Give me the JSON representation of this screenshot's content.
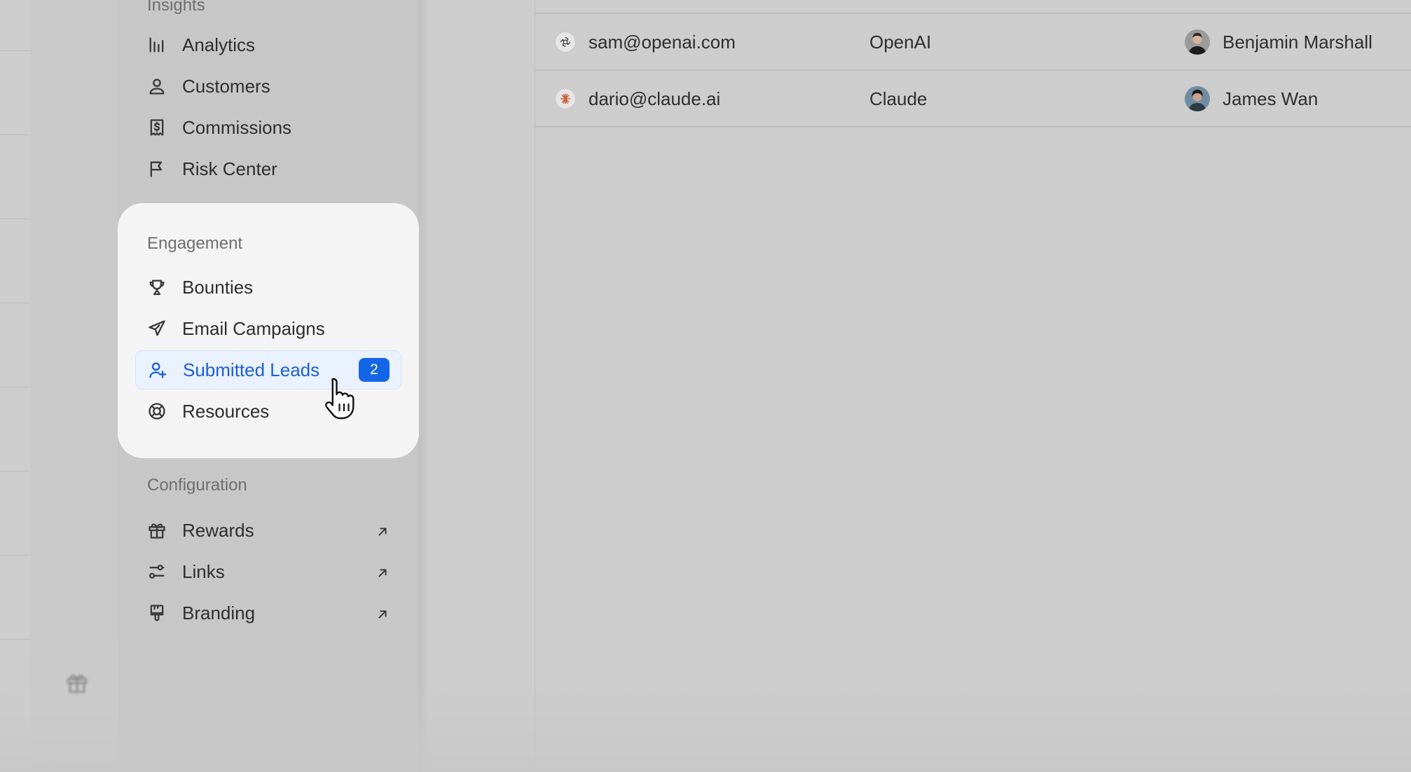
{
  "sidebar": {
    "insights": {
      "label": "Insights",
      "items": [
        {
          "label": "Analytics",
          "icon": "bar-chart-icon"
        },
        {
          "label": "Customers",
          "icon": "user-icon"
        },
        {
          "label": "Commissions",
          "icon": "receipt-dollar-icon"
        },
        {
          "label": "Risk Center",
          "icon": "flag-icon"
        }
      ]
    },
    "engagement": {
      "label": "Engagement",
      "items": [
        {
          "label": "Bounties",
          "icon": "trophy-icon"
        },
        {
          "label": "Email Campaigns",
          "icon": "paper-plane-icon"
        },
        {
          "label": "Submitted Leads",
          "icon": "user-plus-icon",
          "badge": "2",
          "active": true
        },
        {
          "label": "Resources",
          "icon": "lifebuoy-icon"
        }
      ]
    },
    "configuration": {
      "label": "Configuration",
      "items": [
        {
          "label": "Rewards",
          "icon": "gift-icon",
          "external": true
        },
        {
          "label": "Links",
          "icon": "links-icon",
          "external": true
        },
        {
          "label": "Branding",
          "icon": "paintbrush-icon",
          "external": true
        }
      ]
    }
  },
  "table": {
    "rows": [
      {
        "email": "sam@openai.com",
        "company": "OpenAI",
        "owner": "Benjamin Marshall",
        "logo": "openai-logo-icon"
      },
      {
        "email": "dario@claude.ai",
        "company": "Claude",
        "owner": "James Wan",
        "logo": "claude-logo-icon"
      }
    ]
  },
  "colors": {
    "accent": "#1466e8",
    "active_text": "#1a5fd6",
    "active_bg": "#eaf1ff",
    "card_bg": "#f4f4f4",
    "dimmed_bg": "#cdcdcd"
  }
}
